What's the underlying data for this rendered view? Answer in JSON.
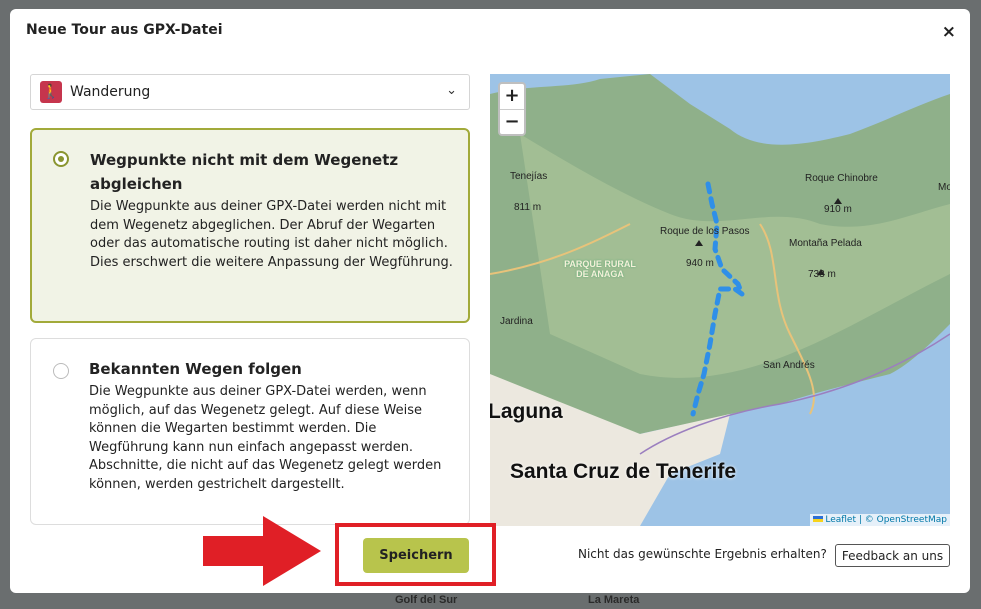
{
  "background": {
    "labels": [
      "Golf del Sur",
      "La Mareta"
    ]
  },
  "dialog": {
    "title": "Neue Tour aus GPX-Datei",
    "close_icon": "×",
    "activity": {
      "icon": "hiker-icon",
      "icon_color": "#c6354d",
      "value": "Wanderung"
    },
    "options": [
      {
        "title": "Wegpunkte nicht mit dem Wegenetz abgleichen",
        "title_display": "Wegpunkte nicht mit dem Wegenetz abglei-chen",
        "text": "Die Wegpunkte aus deiner GPX-Datei werden nicht mit dem Wegenetz abgeglichen. Der Abruf der Wegarten oder das automatische routing ist daher nicht möglich. Dies erschwert die weitere Anpassung der Wegführung.",
        "selected": true
      },
      {
        "title": "Bekannten Wegen folgen",
        "text": "Die Wegpunkte aus deiner GPX-Datei werden, wenn möglich, auf das Wegenetz gelegt. Auf diese Weise können die Wegarten bestimmt werden. Die Wegführung kann nun einfach angepasst werden. Abschnitte, die nicht auf das Wegenetz gelegt werden können, werden gestrichelt dargestellt.",
        "selected": false
      }
    ],
    "map": {
      "zoom_in": "+",
      "zoom_out": "−",
      "attribution": "Leaflet | © OpenStreetMap",
      "labels": {
        "tenejias": "Tenejías",
        "tenejias_ele": "811 m",
        "roque_pasos": "Roque de los Pasos",
        "roque_pasos_ele": "940 m",
        "roque_chinobre": "Roque Chinobre",
        "roque_chinobre_ele": "910 m",
        "montana_pelada": "Montaña Pelada",
        "montana_pelada_ele": "733 m",
        "parque": "PARQUE RURAL DE ANAGA",
        "jardina": "Jardina",
        "san_andres": "San Andrés",
        "laguna": "Laguna",
        "santa_cruz": "Santa Cruz de Tenerife",
        "mo": "Mo"
      },
      "track_color": "#2f8fe8"
    },
    "save_label": "Speichern",
    "feedback_question": "Nicht das gewünschte Ergebnis erhalten?",
    "feedback_label": "Feedback an uns"
  },
  "highlight_color": "#e01f26"
}
